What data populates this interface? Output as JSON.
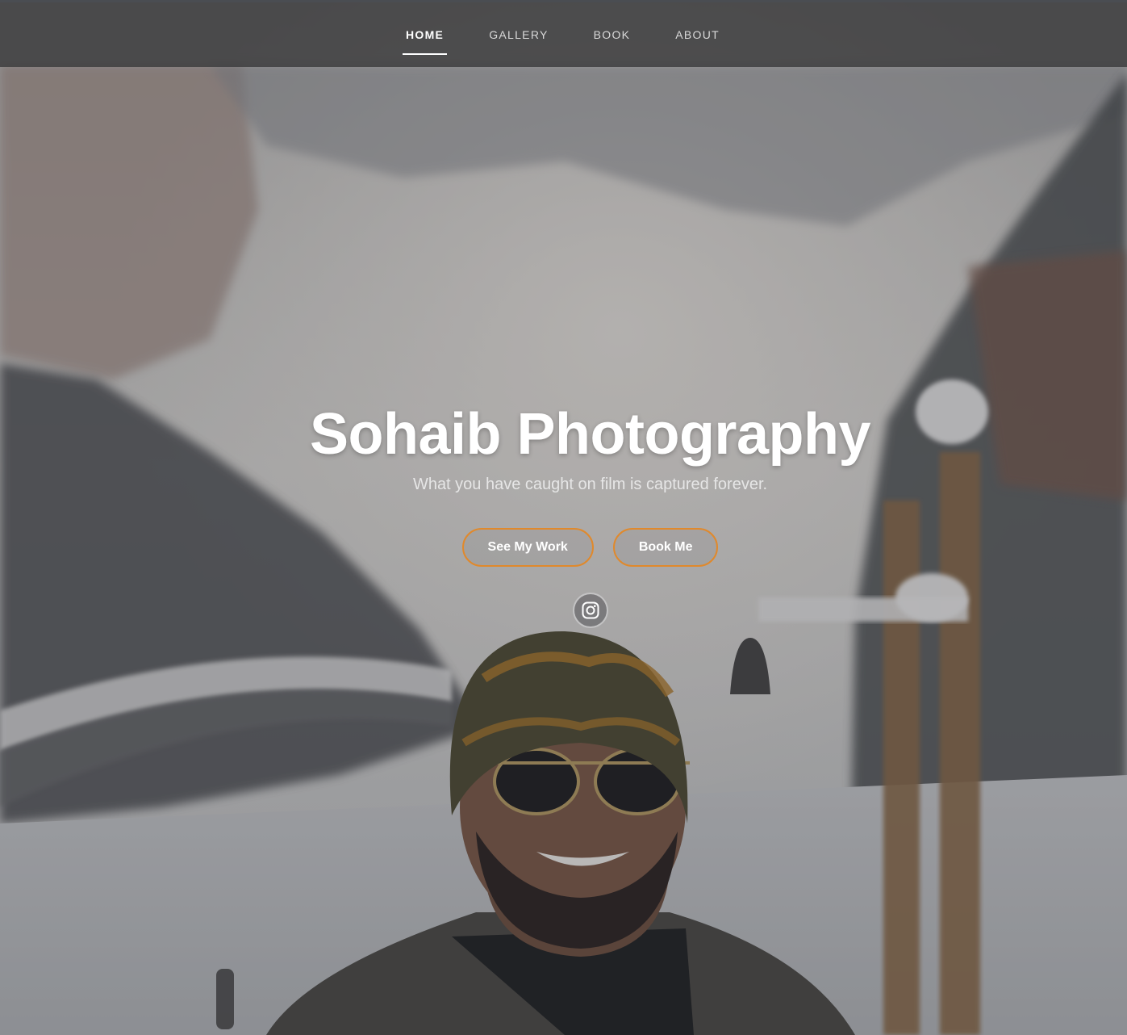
{
  "nav": {
    "items": [
      {
        "label": "HOME",
        "active": true
      },
      {
        "label": "GALLERY",
        "active": false
      },
      {
        "label": "BOOK",
        "active": false
      },
      {
        "label": "ABOUT",
        "active": false
      }
    ]
  },
  "hero": {
    "title": "Sohaib Photography",
    "subtitle": "What you have caught on film is captured forever.",
    "buttons": {
      "primary_label": "See My Work",
      "secondary_label": "Book Me"
    },
    "social_icon": "instagram-icon",
    "background_description_icon": "hero-photo"
  },
  "colors": {
    "accent": "#e0892c",
    "nav_bg": "#3a3a3c",
    "text": "#ffffff"
  }
}
